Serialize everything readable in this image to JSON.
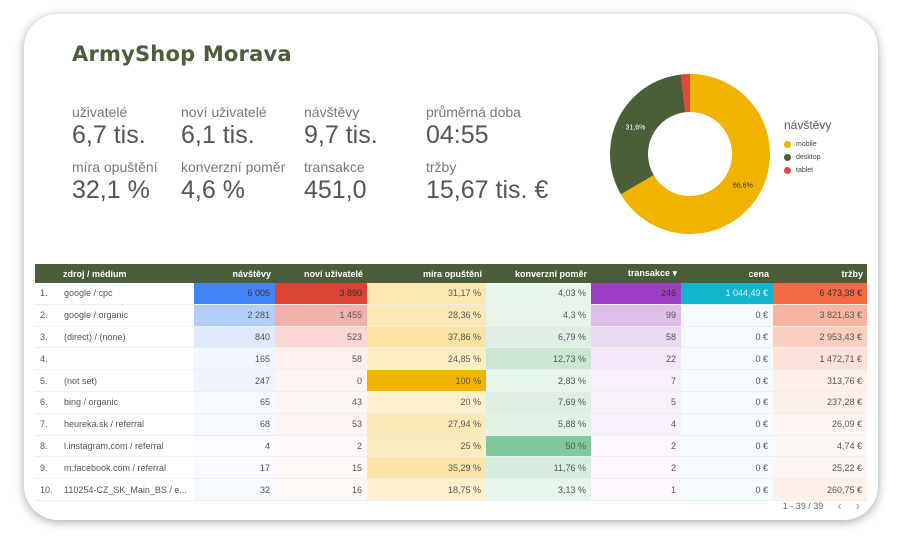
{
  "title": "ArmyShop Morava",
  "kpis": [
    {
      "label": "uživatelé",
      "value": "6,7 tis."
    },
    {
      "label": "noví uživatelé",
      "value": "6,1 tis."
    },
    {
      "label": "návštěvy",
      "value": "9,7 tis."
    },
    {
      "label": "průměrná doba",
      "value": "04:55"
    },
    {
      "label": "míra opuštění",
      "value": "32,1 %"
    },
    {
      "label": "konverzní poměr",
      "value": "4,6 %"
    },
    {
      "label": "transakce",
      "value": "451,0"
    },
    {
      "label": "tržby",
      "value": "15,67 tis. €"
    }
  ],
  "chart_data": {
    "type": "pie",
    "title": "",
    "legend_title": "návštěvy",
    "legend_position": "right",
    "categories": [
      "mobile",
      "desktop",
      "tablet"
    ],
    "values": [
      66.6,
      31.6,
      1.8
    ],
    "labels": [
      "66,6%",
      "31,6%",
      ""
    ],
    "colors": [
      "#f2b300",
      "#4a5e37",
      "#e0493b"
    ]
  },
  "table": {
    "headers": [
      "",
      "zdroj / médium",
      "návštěvy",
      "noví uživatelé",
      "míra opuštění",
      "konverzní poměr",
      "transakce",
      "cena",
      "tržby"
    ],
    "sort_indicator": "▾",
    "rows": [
      [
        "1.",
        "google / cpc",
        "6 005",
        "3 890",
        "31,17 %",
        "4,03 %",
        "246",
        "1 044,49 €",
        "6 473,38 €"
      ],
      [
        "2.",
        "google / organic",
        "2 281",
        "1 455",
        "28,36 %",
        "4,3 %",
        "99",
        "0 €",
        "3 821,63 €"
      ],
      [
        "3.",
        "(direct) / (none)",
        "840",
        "523",
        "37,86 %",
        "6,79 %",
        "58",
        "0 €",
        "2 953,43 €"
      ],
      [
        "4.",
        "",
        "165",
        "58",
        "24,85 %",
        "12,73 %",
        "22",
        "0 €",
        "1 472,71 €"
      ],
      [
        "5.",
        "(not set)",
        "247",
        "0",
        "100 %",
        "2,83 %",
        "7",
        "0 €",
        "313,76 €"
      ],
      [
        "6.",
        "bing / organic",
        "65",
        "43",
        "20 %",
        "7,69 %",
        "5",
        "0 €",
        "237,28 €"
      ],
      [
        "7.",
        "heureka.sk / referral",
        "68",
        "53",
        "27,94 %",
        "5,88 %",
        "4",
        "0 €",
        "26,09 €"
      ],
      [
        "8.",
        "l.instagram.com / referral",
        "4",
        "2",
        "25 %",
        "50 %",
        "2",
        "0 €",
        "4,74 €"
      ],
      [
        "9.",
        "m.facebook.com / referral",
        "17",
        "15",
        "35,29 %",
        "11,76 %",
        "2",
        "0 €",
        "25,22 €"
      ],
      [
        "10.",
        "110254-CZ_SK_Main_BS / e...",
        "32",
        "16",
        "18,75 %",
        "3,13 %",
        "1",
        "0 €",
        "260,75 €"
      ]
    ]
  },
  "pager": {
    "text": "1 - 39 / 39",
    "prev": "‹",
    "next": "›"
  }
}
